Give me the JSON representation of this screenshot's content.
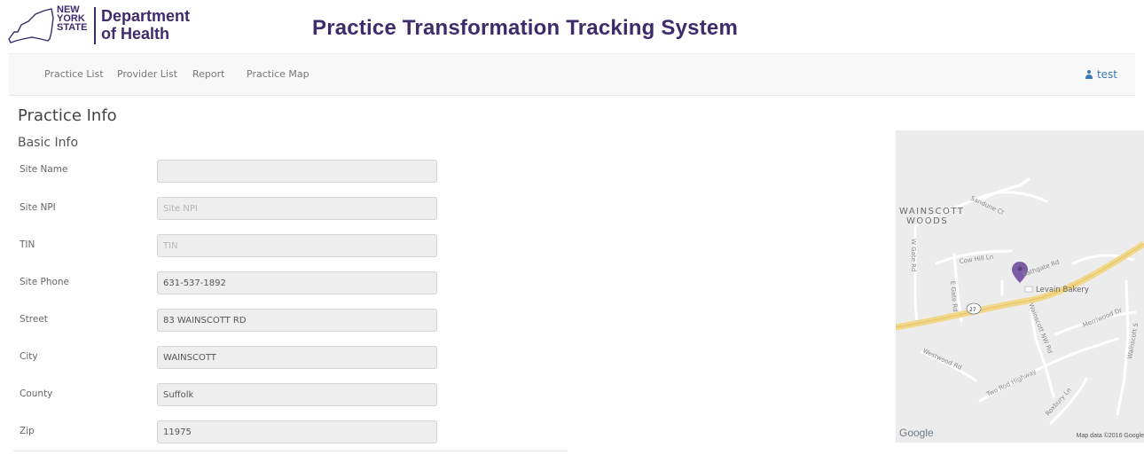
{
  "header": {
    "logo_line1": "NEW",
    "logo_line2": "YORK",
    "logo_line3": "STATE",
    "dept_line1": "Department",
    "dept_line2": "of Health",
    "app_title": "Practice Transformation Tracking System"
  },
  "nav": {
    "items": [
      "Practice List",
      "Provider List",
      "Report",
      "Practice Map"
    ],
    "user_label": "test"
  },
  "page": {
    "title": "Practice Info",
    "section": "Basic Info"
  },
  "form": {
    "fields": [
      {
        "label": "Site Name",
        "value": "",
        "placeholder": ""
      },
      {
        "label": "Site NPI",
        "value": "",
        "placeholder": "Site NPI"
      },
      {
        "label": "TIN",
        "value": "",
        "placeholder": "TIN"
      },
      {
        "label": "Site Phone",
        "value": "631-537-1892",
        "placeholder": ""
      },
      {
        "label": "Street",
        "value": "83 WAINSCOTT RD",
        "placeholder": ""
      },
      {
        "label": "City",
        "value": "WAINSCOTT",
        "placeholder": ""
      },
      {
        "label": "County",
        "value": "Suffolk",
        "placeholder": ""
      },
      {
        "label": "Zip",
        "value": "11975",
        "placeholder": ""
      }
    ]
  },
  "map": {
    "area_line1": "WAINSCOTT",
    "area_line2": "WOODS",
    "streets": {
      "sandune": "Sandune Ct",
      "wgate": "W Gate Rd",
      "egate": "E Gate Rd",
      "cowhill": "Cow Hill Ln",
      "bathgate": "Bathgate Rd",
      "wainscott_nw": "Wainscott NW Rd",
      "merriwood": "Merriwood Dr",
      "westwood": "Westwood Rd",
      "tworod": "Two Rod Highway",
      "roxbury": "Roxbury Ln",
      "wainscott_s": "Wainscott S"
    },
    "poi": "Levain Bakery",
    "route_shield": "27",
    "brand": "Google",
    "attribution": "Map data ©2016 Google",
    "colors": {
      "road_major": "#f1d789",
      "pin": "#7b5aa6",
      "background": "#ececec"
    }
  }
}
